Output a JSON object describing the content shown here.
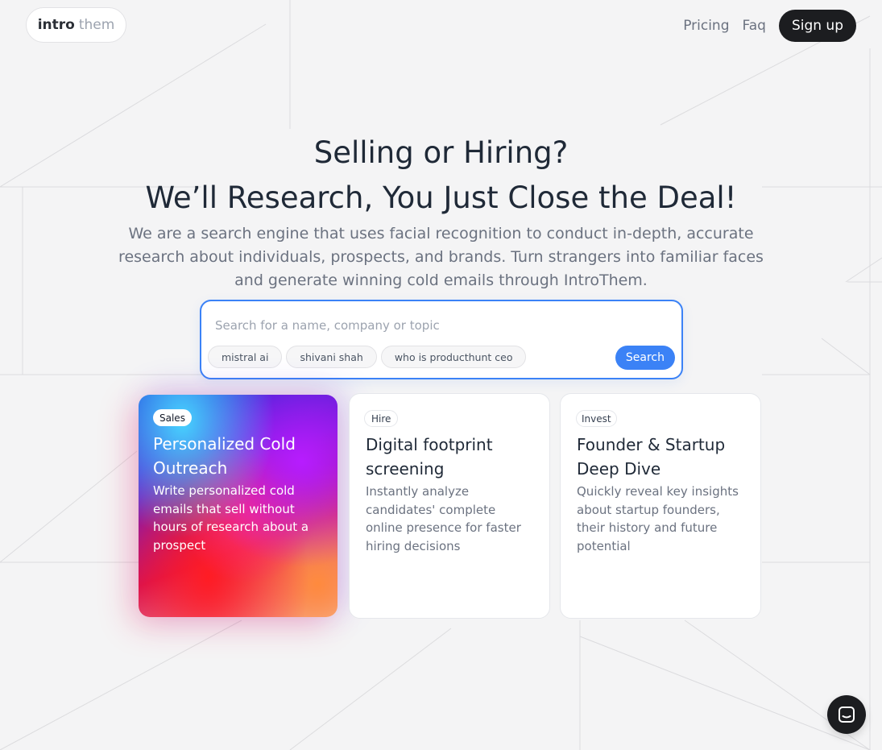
{
  "header": {
    "logo_word_1": "intro",
    "logo_word_2": "them",
    "nav": {
      "pricing": "Pricing",
      "faq": "Faq",
      "signup": "Sign up"
    }
  },
  "hero": {
    "title_line_1": "Selling or Hiring?",
    "title_line_2": "We’ll Research, You Just Close the Deal!",
    "subtitle": "We are a search engine that uses facial recognition to conduct in-depth, accurate research about individuals, prospects, and brands. Turn strangers into familiar faces and generate winning cold emails through IntroThem."
  },
  "search": {
    "placeholder": "Search for a name, company or topic",
    "value": "",
    "suggestions": [
      "mistral ai",
      "shivani shah",
      "who is producthunt ceo"
    ],
    "button_label": "Search"
  },
  "cards": [
    {
      "badge": "Sales",
      "title": "Personalized Cold Outreach",
      "description": "Write personalized cold emails that sell without hours of research about a prospect"
    },
    {
      "badge": "Hire",
      "title": "Digital footprint screening",
      "description": "Instantly analyze candidates' complete online presence for faster hiring decisions"
    },
    {
      "badge": "Invest",
      "title": "Founder & Startup Deep Dive",
      "description": "Quickly reveal key insights about startup founders, their history and future potential"
    }
  ],
  "chat_widget": {
    "icon": "chat-bubble-icon"
  },
  "colors": {
    "accent": "#3b82f6",
    "dark": "#1c1d20",
    "background": "#f4f4f5"
  }
}
